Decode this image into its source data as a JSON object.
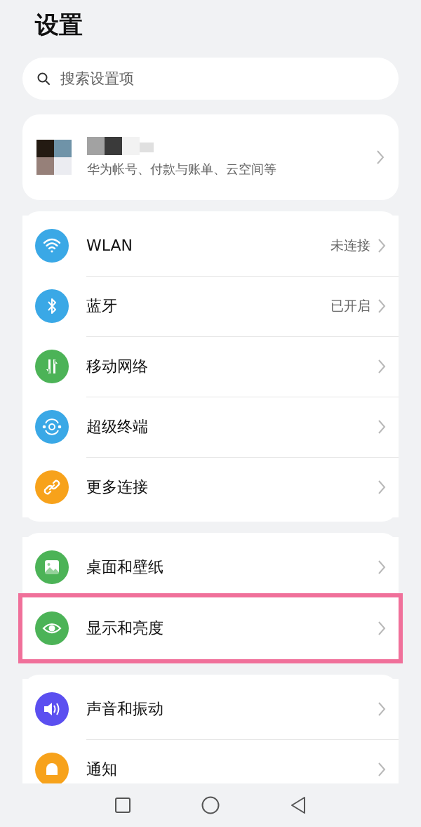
{
  "title": "设置",
  "search": {
    "placeholder": "搜索设置项"
  },
  "account": {
    "subtitle": "华为帐号、付款与账单、云空间等"
  },
  "groups": [
    {
      "items": [
        {
          "kind": "wifi",
          "color": "#3aa8e6",
          "label": "WLAN",
          "value": "未连接",
          "highlighted": false
        },
        {
          "kind": "bluetooth",
          "color": "#3aa8e6",
          "label": "蓝牙",
          "value": "已开启",
          "highlighted": false
        },
        {
          "kind": "mobile",
          "color": "#4cb357",
          "label": "移动网络",
          "highlighted": false
        },
        {
          "kind": "terminal",
          "color": "#3aa8e6",
          "label": "超级终端",
          "highlighted": false
        },
        {
          "kind": "link",
          "color": "#f7a21b",
          "label": "更多连接",
          "highlighted": false
        }
      ]
    },
    {
      "items": [
        {
          "kind": "wallpaper",
          "color": "#4cb357",
          "label": "桌面和壁纸",
          "highlighted": false
        },
        {
          "kind": "eye",
          "color": "#4cb357",
          "label": "显示和亮度",
          "highlighted": true
        }
      ]
    },
    {
      "items": [
        {
          "kind": "sound",
          "color": "#5b4ff0",
          "label": "声音和振动",
          "highlighted": false
        },
        {
          "kind": "bell",
          "color": "#f7a21b",
          "label": "通知",
          "highlighted": false
        }
      ]
    }
  ]
}
